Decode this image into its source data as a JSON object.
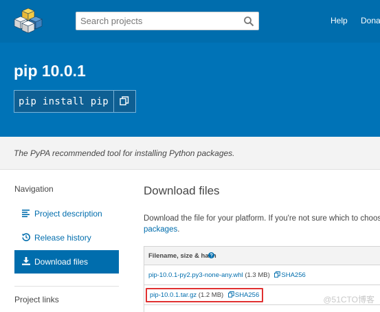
{
  "header": {
    "search": {
      "placeholder": "Search projects",
      "value": ""
    },
    "nav": [
      {
        "label": "Help"
      },
      {
        "label": "Donat"
      }
    ],
    "brand_colors": {
      "bar": "#006dad",
      "hero": "#0073b7"
    }
  },
  "hero": {
    "title": "pip 10.0.1",
    "install_command": "pip install pip",
    "copy_icon": "copy-icon"
  },
  "summary": "The PyPA recommended tool for installing Python packages.",
  "sidebar": {
    "navigation_heading": "Navigation",
    "items": [
      {
        "label": "Project description",
        "icon": "align-left-icon",
        "active": false
      },
      {
        "label": "Release history",
        "icon": "history-icon",
        "active": false
      },
      {
        "label": "Download files",
        "icon": "download-icon",
        "active": true
      }
    ],
    "project_links_heading": "Project links"
  },
  "main": {
    "title": "Download files",
    "description_line1": "Download the file for your platform. If you're not sure which to choose, lea",
    "description_link": "packages",
    "description_end": ".",
    "table": {
      "header": "Filename, size & hash",
      "rows": [
        {
          "filename": "pip-10.0.1-py2.py3-none-any.whl",
          "size": "(1.3 MB)",
          "hash": "SHA256",
          "highlighted": false
        },
        {
          "filename": "pip-10.0.1.tar.gz",
          "size": "(1.2 MB)",
          "hash": "SHA256",
          "highlighted": true
        }
      ]
    }
  },
  "watermark": "@51CTO博客"
}
